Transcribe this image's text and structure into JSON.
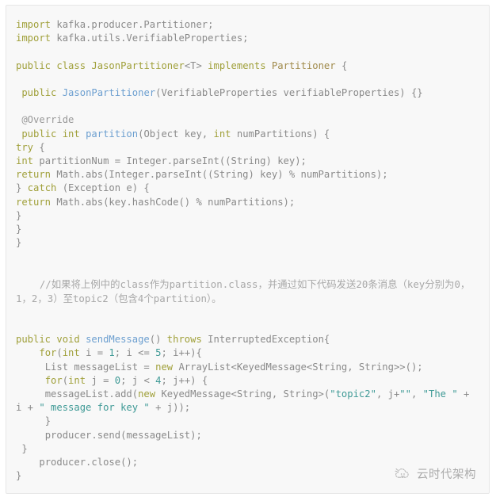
{
  "card": {
    "background": "#f8f8f8",
    "border_color": "#e7e7e7"
  },
  "colors": {
    "keyword": "#a0a03a",
    "function": "#6c9fd0",
    "type": "#a08a4a",
    "string": "#3f9a96",
    "number": "#3f9a96",
    "annotation": "#999999",
    "comment": "#a8a8a8",
    "plain": "#8a8a8a"
  },
  "code": {
    "language": "java",
    "lines": [
      "import kafka.producer.Partitioner;",
      "import kafka.utils.VerifiableProperties;",
      "",
      "public class JasonPartitioner<T> implements Partitioner {",
      "",
      " public JasonPartitioner(VerifiableProperties verifiableProperties) {}",
      "",
      " @Override",
      " public int partition(Object key, int numPartitions) {",
      " try {",
      " int partitionNum = Integer.parseInt((String) key);",
      " return Math.abs(Integer.parseInt((String) key) % numPartitions);",
      " } catch (Exception e) {",
      " return Math.abs(key.hashCode() % numPartitions);",
      " }",
      " }",
      "}",
      "",
      "",
      "    //如果将上例中的class作为partition.class，并通过如下代码发送20条消息（key分别为0，1，2，3）至topic2（包含4个partition）。",
      "",
      "",
      "public void sendMessage() throws InterruptedException{",
      "    for(int i = 1; i <= 5; i++){",
      "     List messageList = new ArrayList<KeyedMessage<String, String>>();",
      "     for(int j = 0; j < 4; j++) {",
      "     messageList.add(new KeyedMessage<String, String>(\"topic2\", j+\"\", \"The \" + i + \" message for key \" + j));",
      "     }",
      "     producer.send(messageList);",
      " }",
      "    producer.close();",
      "}"
    ]
  },
  "comment_text": {
    "prefix": "    //",
    "segment_1": "如果将上例中的",
    "code_1": "class",
    "segment_2": "作为",
    "code_2": "partition.class",
    "segment_3": "，并通过如下代码发送",
    "code_3": "20",
    "segment_4": "条消息（",
    "code_4": "key",
    "segment_5": "分别为",
    "code_5": "0",
    "segment_6": "，",
    "code_6": "1",
    "segment_7": "，",
    "code_7": "2",
    "segment_8": "，",
    "code_8": "3",
    "segment_9": "）至",
    "code_9": "topic2",
    "segment_10": "（包含",
    "code_10": "4",
    "segment_11": "个",
    "code_11": "partition",
    "segment_12": "）。"
  },
  "watermark": {
    "icon": "cloud-icon",
    "label": "云时代架构",
    "color": "#7c7c7c"
  }
}
